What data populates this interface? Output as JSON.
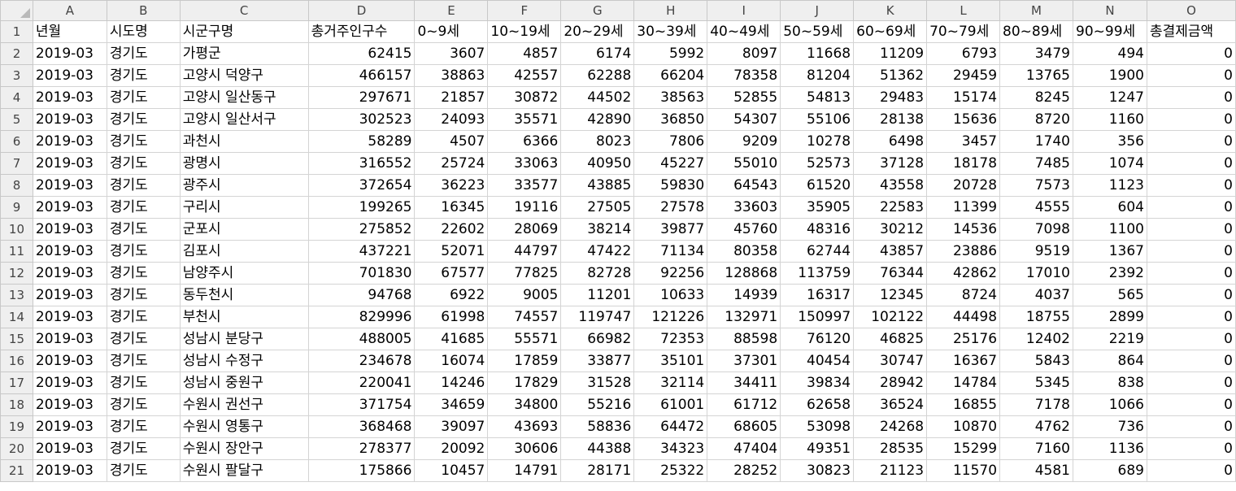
{
  "spreadsheet": {
    "column_letters": [
      "A",
      "B",
      "C",
      "D",
      "E",
      "F",
      "G",
      "H",
      "I",
      "J",
      "K",
      "L",
      "M",
      "N",
      "O"
    ],
    "headers": [
      "년월",
      "시도명",
      "시군구명",
      "총거주인구수",
      "0~9세",
      "10~19세",
      "20~29세",
      "30~39세",
      "40~49세",
      "50~59세",
      "60~69세",
      "70~79세",
      "80~89세",
      "90~99세",
      "총결제금액"
    ],
    "rows": [
      [
        "2019-03",
        "경기도",
        "가평군",
        "62415",
        "3607",
        "4857",
        "6174",
        "5992",
        "8097",
        "11668",
        "11209",
        "6793",
        "3479",
        "494",
        "0"
      ],
      [
        "2019-03",
        "경기도",
        "고양시 덕양구",
        "466157",
        "38863",
        "42557",
        "62288",
        "66204",
        "78358",
        "81204",
        "51362",
        "29459",
        "13765",
        "1900",
        "0"
      ],
      [
        "2019-03",
        "경기도",
        "고양시 일산동구",
        "297671",
        "21857",
        "30872",
        "44502",
        "38563",
        "52855",
        "54813",
        "29483",
        "15174",
        "8245",
        "1247",
        "0"
      ],
      [
        "2019-03",
        "경기도",
        "고양시 일산서구",
        "302523",
        "24093",
        "35571",
        "42890",
        "36850",
        "54307",
        "55106",
        "28138",
        "15636",
        "8720",
        "1160",
        "0"
      ],
      [
        "2019-03",
        "경기도",
        "과천시",
        "58289",
        "4507",
        "6366",
        "8023",
        "7806",
        "9209",
        "10278",
        "6498",
        "3457",
        "1740",
        "356",
        "0"
      ],
      [
        "2019-03",
        "경기도",
        "광명시",
        "316552",
        "25724",
        "33063",
        "40950",
        "45227",
        "55010",
        "52573",
        "37128",
        "18178",
        "7485",
        "1074",
        "0"
      ],
      [
        "2019-03",
        "경기도",
        "광주시",
        "372654",
        "36223",
        "33577",
        "43885",
        "59830",
        "64543",
        "61520",
        "43558",
        "20728",
        "7573",
        "1123",
        "0"
      ],
      [
        "2019-03",
        "경기도",
        "구리시",
        "199265",
        "16345",
        "19116",
        "27505",
        "27578",
        "33603",
        "35905",
        "22583",
        "11399",
        "4555",
        "604",
        "0"
      ],
      [
        "2019-03",
        "경기도",
        "군포시",
        "275852",
        "22602",
        "28069",
        "38214",
        "39877",
        "45760",
        "48316",
        "30212",
        "14536",
        "7098",
        "1100",
        "0"
      ],
      [
        "2019-03",
        "경기도",
        "김포시",
        "437221",
        "52071",
        "44797",
        "47422",
        "71134",
        "80358",
        "62744",
        "43857",
        "23886",
        "9519",
        "1367",
        "0"
      ],
      [
        "2019-03",
        "경기도",
        "남양주시",
        "701830",
        "67577",
        "77825",
        "82728",
        "92256",
        "128868",
        "113759",
        "76344",
        "42862",
        "17010",
        "2392",
        "0"
      ],
      [
        "2019-03",
        "경기도",
        "동두천시",
        "94768",
        "6922",
        "9005",
        "11201",
        "10633",
        "14939",
        "16317",
        "12345",
        "8724",
        "4037",
        "565",
        "0"
      ],
      [
        "2019-03",
        "경기도",
        "부천시",
        "829996",
        "61998",
        "74557",
        "119747",
        "121226",
        "132971",
        "150997",
        "102122",
        "44498",
        "18755",
        "2899",
        "0"
      ],
      [
        "2019-03",
        "경기도",
        "성남시 분당구",
        "488005",
        "41685",
        "55571",
        "66982",
        "72353",
        "88598",
        "76120",
        "46825",
        "25176",
        "12402",
        "2219",
        "0"
      ],
      [
        "2019-03",
        "경기도",
        "성남시 수정구",
        "234678",
        "16074",
        "17859",
        "33877",
        "35101",
        "37301",
        "40454",
        "30747",
        "16367",
        "5843",
        "864",
        "0"
      ],
      [
        "2019-03",
        "경기도",
        "성남시 중원구",
        "220041",
        "14246",
        "17829",
        "31528",
        "32114",
        "34411",
        "39834",
        "28942",
        "14784",
        "5345",
        "838",
        "0"
      ],
      [
        "2019-03",
        "경기도",
        "수원시 권선구",
        "371754",
        "34659",
        "34800",
        "55216",
        "61001",
        "61712",
        "62658",
        "36524",
        "16855",
        "7178",
        "1066",
        "0"
      ],
      [
        "2019-03",
        "경기도",
        "수원시 영통구",
        "368468",
        "39097",
        "43693",
        "58836",
        "64472",
        "68605",
        "53098",
        "24268",
        "10870",
        "4762",
        "736",
        "0"
      ],
      [
        "2019-03",
        "경기도",
        "수원시 장안구",
        "278377",
        "20092",
        "30606",
        "44388",
        "34323",
        "47404",
        "49351",
        "28535",
        "15299",
        "7160",
        "1136",
        "0"
      ],
      [
        "2019-03",
        "경기도",
        "수원시 팔달구",
        "175866",
        "10457",
        "14791",
        "28171",
        "25322",
        "28252",
        "30823",
        "21123",
        "11570",
        "4581",
        "689",
        "0"
      ]
    ]
  }
}
